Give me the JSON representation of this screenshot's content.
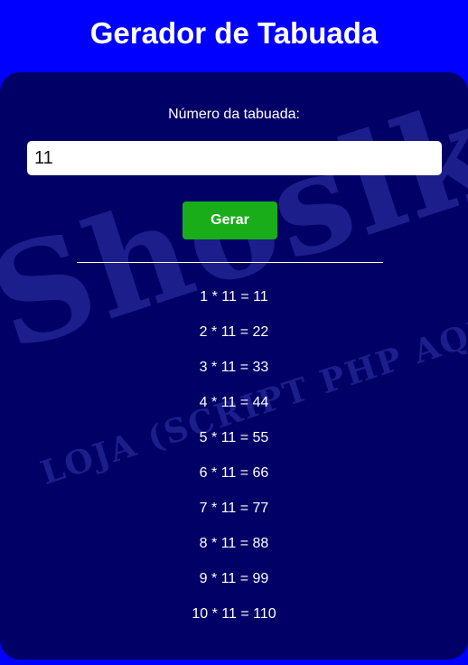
{
  "header": {
    "title": "Gerador de Tabuada"
  },
  "watermark": {
    "main": "Shoslk",
    "sub": "LOJA (SCRIPT PHP AQUI"
  },
  "form": {
    "label": "Número da tabuada:",
    "input_value": "11",
    "button_label": "Gerar"
  },
  "results": [
    "1 * 11 = 11",
    "2 * 11 = 22",
    "3 * 11 = 33",
    "4 * 11 = 44",
    "5 * 11 = 55",
    "6 * 11 = 66",
    "7 * 11 = 77",
    "8 * 11 = 88",
    "9 * 11 = 99",
    "10 * 11 = 110"
  ],
  "colors": {
    "page_background": "#0000ff",
    "card_background": "#000066",
    "button_background": "#1aad1a",
    "text": "#ffffff"
  }
}
